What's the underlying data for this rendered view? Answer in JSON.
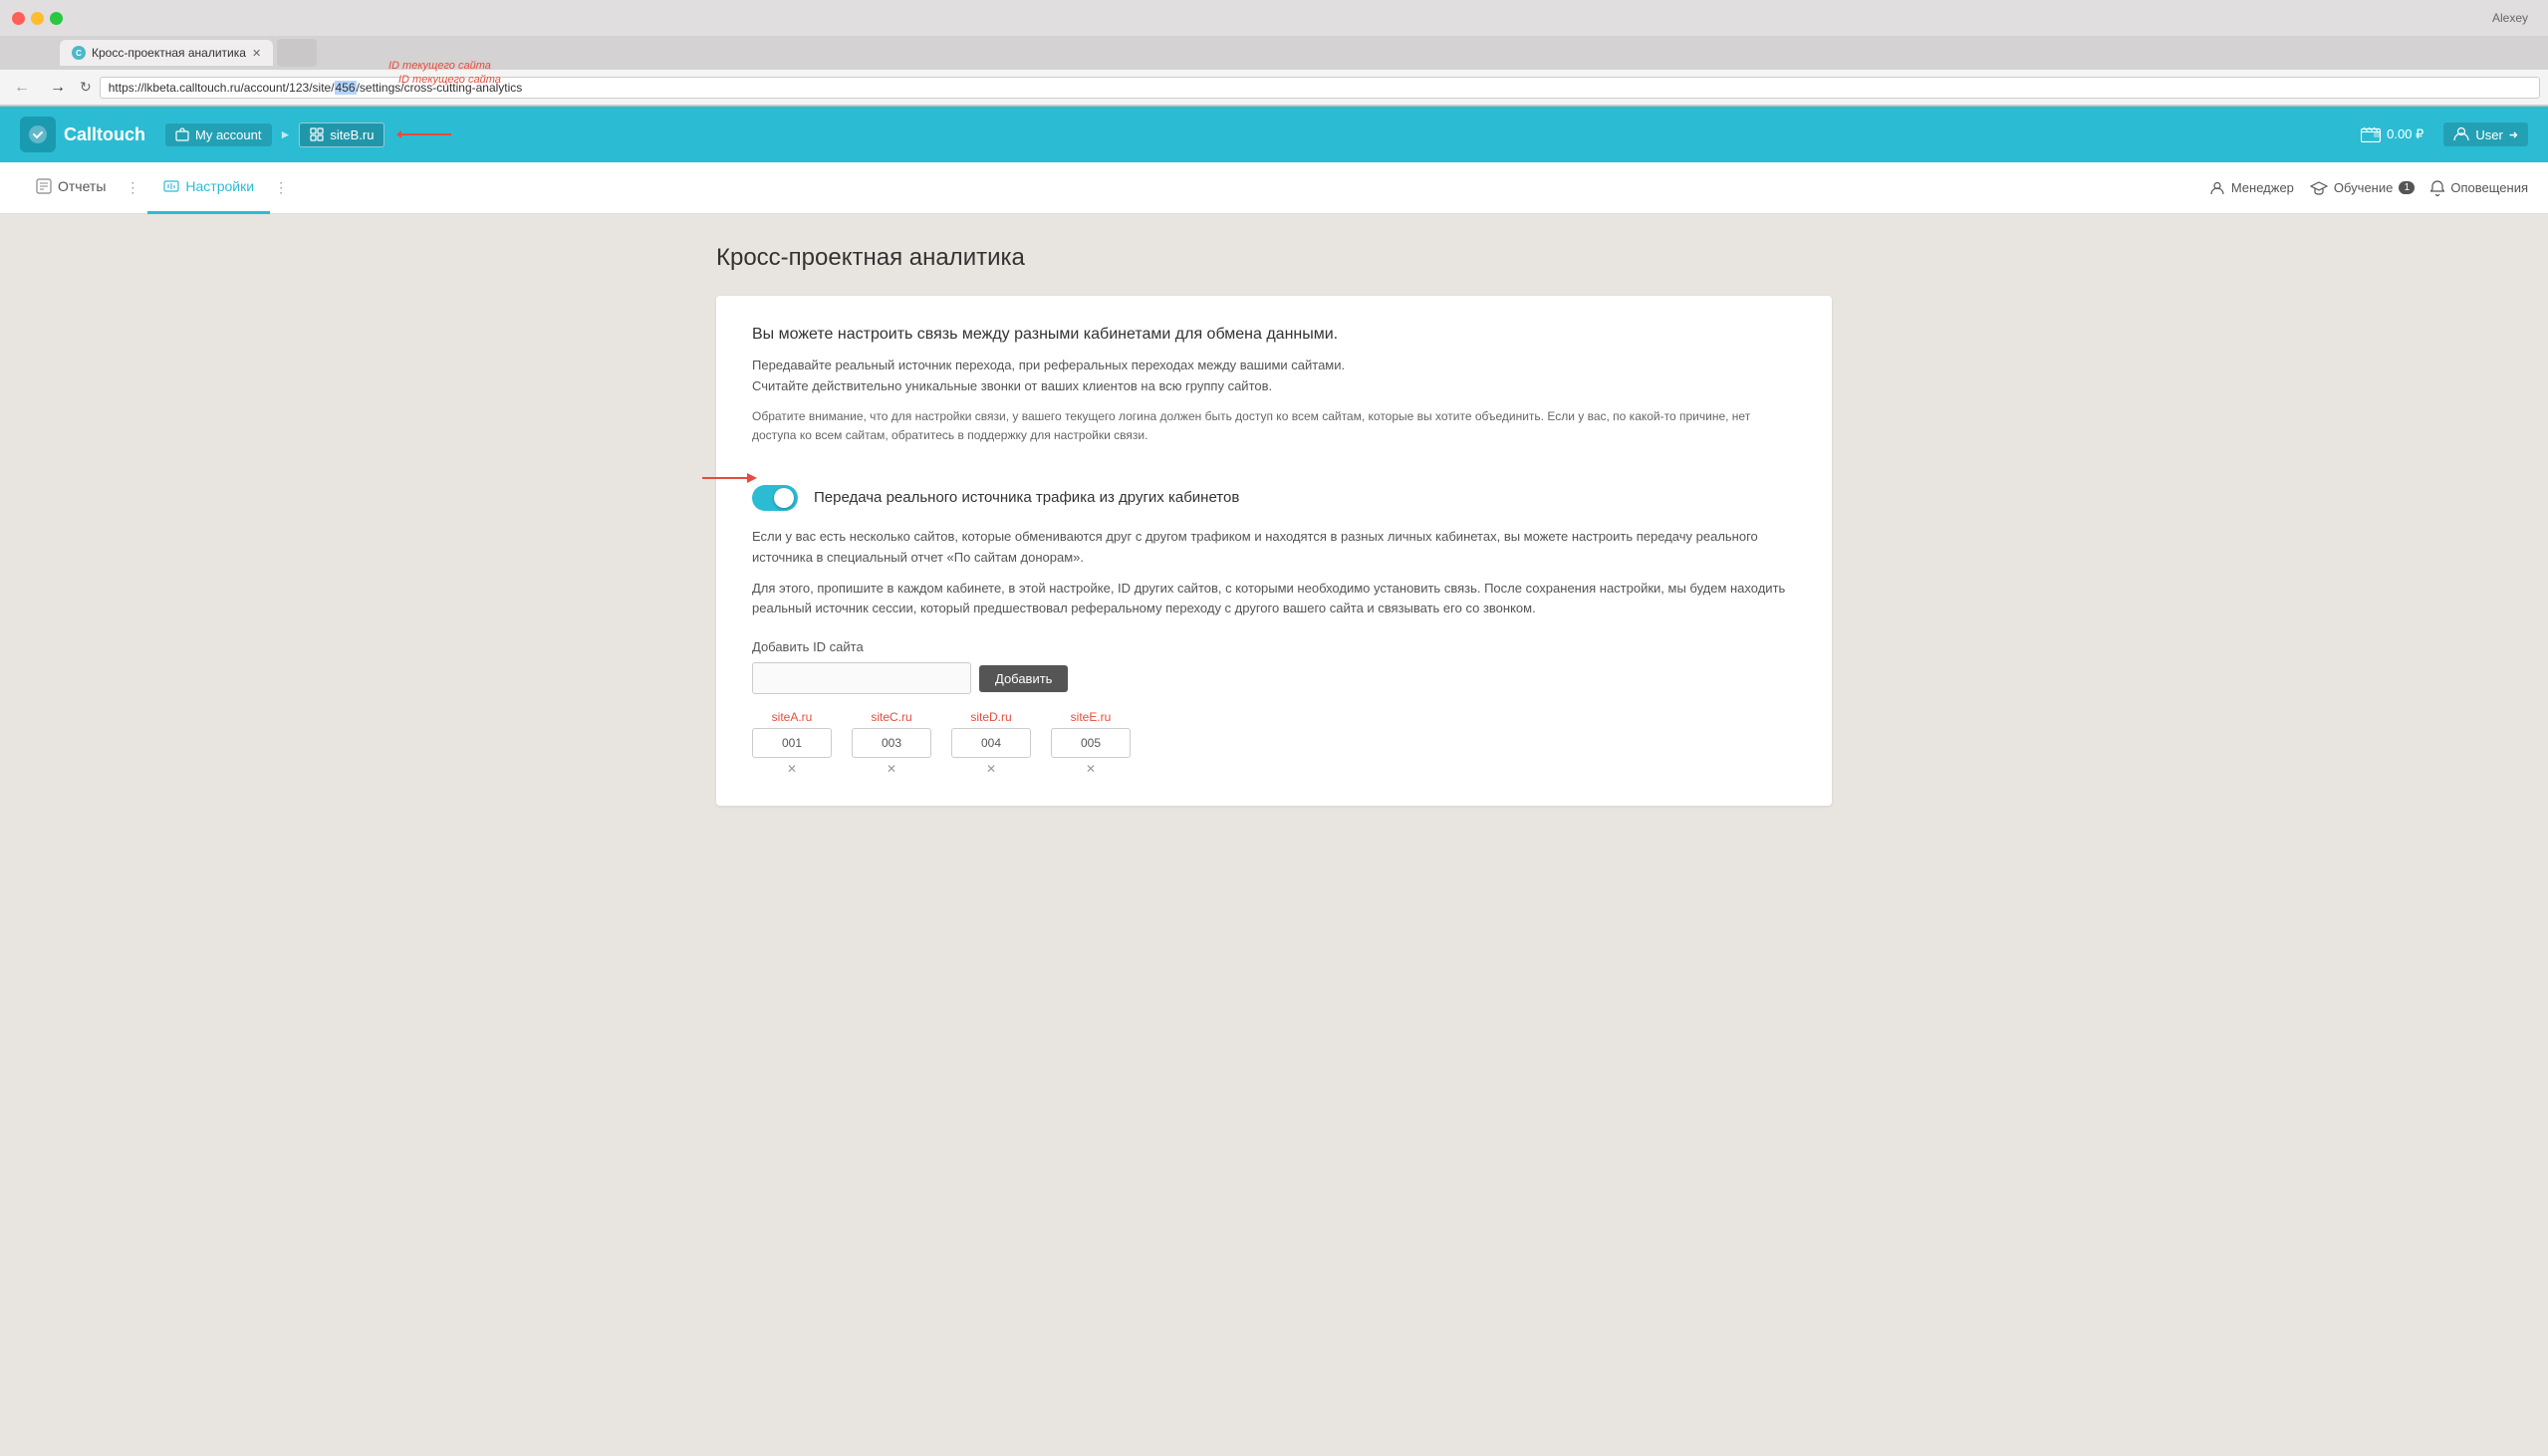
{
  "browser": {
    "tab_title": "Кросс-проектная аналитика",
    "url_prefix": "https://lkbeta.calltouch.ru/account/123/site/",
    "url_highlighted": "456",
    "url_suffix": "/settings/cross-cutting-analytics",
    "url_annotation": "ID текущего сайта",
    "user_name": "Alexey"
  },
  "header": {
    "logo_text": "Calltouch",
    "logo_letter": "C",
    "breadcrumb_account": "My account",
    "breadcrumb_site": "siteB.ru",
    "balance": "0.00 ₽",
    "user_label": "User"
  },
  "nav": {
    "items": [
      {
        "id": "reports",
        "label": "Отчеты",
        "active": false
      },
      {
        "id": "settings",
        "label": "Настройки",
        "active": true
      }
    ],
    "right_items": [
      {
        "id": "manager",
        "label": "Менеджер"
      },
      {
        "id": "education",
        "label": "Обучение",
        "badge": "1"
      },
      {
        "id": "notifications",
        "label": "Оповещения"
      }
    ]
  },
  "page": {
    "title": "Кросс-проектная аналитика",
    "intro_heading": "Вы можете настроить связь между разными кабинетами для обмена данными.",
    "intro_para1": "Передавайте реальный источник перехода, при реферальных переходах между вашими сайтами.\nСчитайте действительно уникальные звонки от ваших клиентов на всю группу сайтов.",
    "intro_para2": "Обратите внимание, что для настройки связи, у вашего текущего логина должен быть доступ ко всем сайтам, которые вы хотите объединить. Если у вас, по какой-то причине, нет доступа ко всем сайтам, обратитесь в поддержку для настройки связи.",
    "toggle_label": "Передача реального источника трафика из других кабинетов",
    "toggle_on": true,
    "section_para1": "Если у вас есть несколько сайтов, которые обмениваются друг с другом трафиком и находятся в разных личных кабинетах, вы можете настроить передачу реального источника в специальный отчет «По сайтам донорам».",
    "section_para2": "Для этого, пропишите в каждом кабинете, в этой настройке, ID других сайтов, с которыми необходимо установить связь. После сохранения настройки, мы будем находить реальный источник сессии, который предшествовал реферальному переходу с другого вашего сайта и связывать его со звонком.",
    "add_id_label": "Добавить ID сайта",
    "add_btn_label": "Добавить",
    "id_input_placeholder": "",
    "sites": [
      {
        "name": "siteA.ru",
        "id": "001"
      },
      {
        "name": "siteC.ru",
        "id": "003"
      },
      {
        "name": "siteD.ru",
        "id": "004"
      },
      {
        "name": "siteE.ru",
        "id": "005"
      }
    ]
  }
}
